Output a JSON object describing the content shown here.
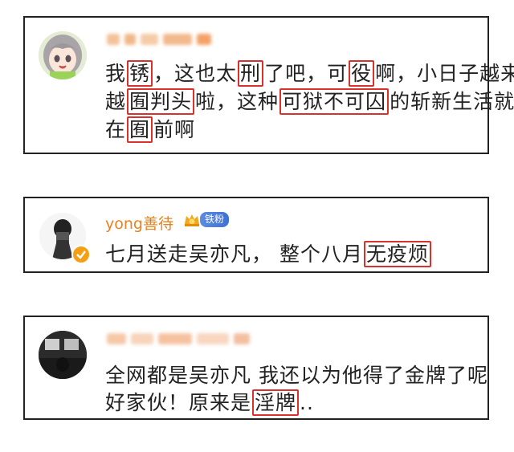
{
  "comments": [
    {
      "line1": {
        "a": "我",
        "b": "锈",
        "c": "，这也太",
        "d": "刑",
        "e": "了吧，可",
        "f": "役",
        "g": "啊，小日子越来"
      },
      "line2": {
        "a": "越",
        "b": "囿判头",
        "c": "啦，这种",
        "d": "可狱不可囚",
        "e": "的斩新生活就"
      },
      "line3": {
        "a": "在",
        "b": "囿",
        "c": "前啊"
      }
    },
    {
      "username": "yong善待",
      "fan_badge": "铁粉",
      "text": {
        "a": "七月送走吴亦凡，  整个八月",
        "b": "无疫烦"
      }
    },
    {
      "line1": "全网都是吴亦凡 我还以为他得了金牌了呢",
      "line2": {
        "a": "好家伙！原来是",
        "b": "淫牌",
        "c": ".."
      }
    }
  ],
  "colors": {
    "highlight_box": "#d9312b",
    "username": "#e8811e",
    "border": "#222222"
  }
}
